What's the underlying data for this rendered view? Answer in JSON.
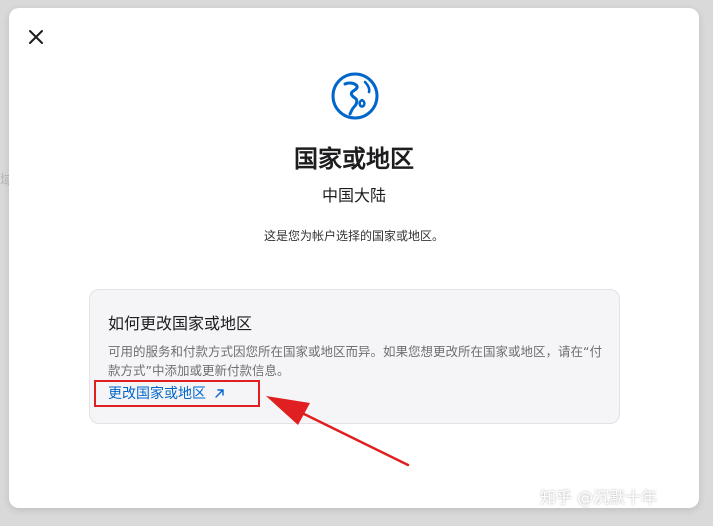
{
  "dialog": {
    "title": "国家或地区",
    "current_region": "中国大陆",
    "description": "这是您为帐户选择的国家或地区。"
  },
  "card": {
    "title": "如何更改国家或地区",
    "body": "可用的服务和付款方式因您所在国家或地区而异。如果您想更改所在国家或地区，请在“付款方式”中添加或更新付款信息。",
    "link_label": "更改国家或地区"
  },
  "icons": {
    "close": "close-icon",
    "globe": "globe-icon",
    "external": "arrow-up-right-icon"
  },
  "colors": {
    "accent": "#0066cc",
    "annotation": "#e02020"
  },
  "watermark": "知乎 @沉默十年"
}
